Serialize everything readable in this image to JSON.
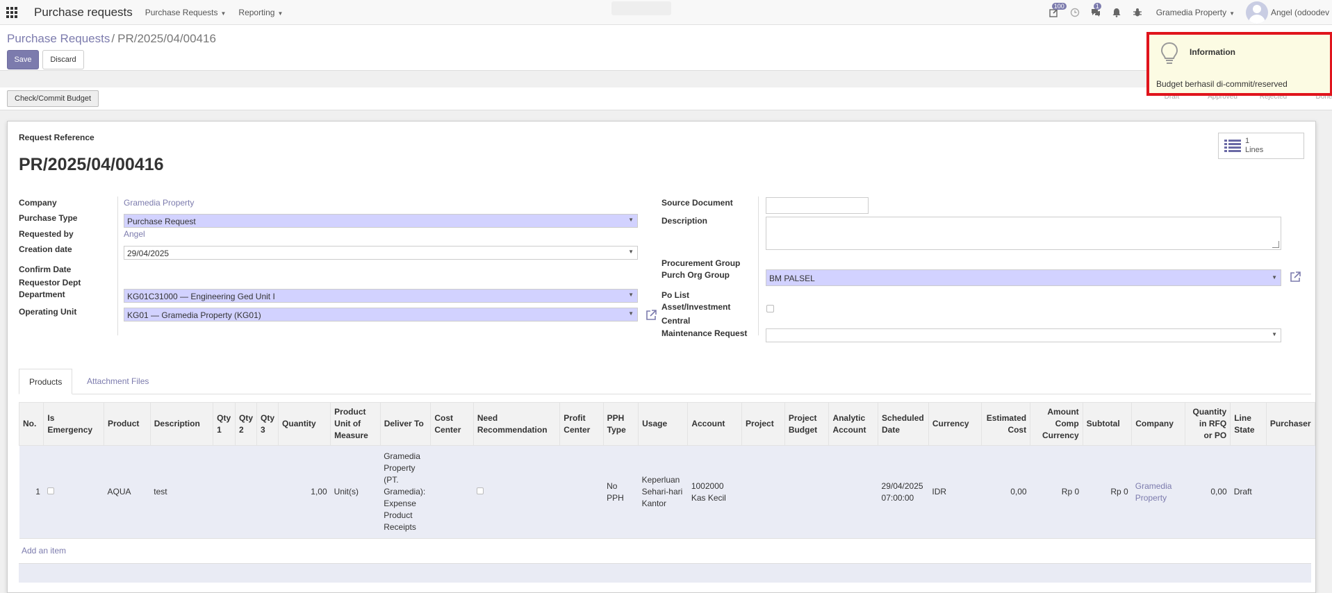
{
  "topnav": {
    "app_title": "Purchase requests",
    "menus": [
      "Purchase Requests",
      "Reporting"
    ],
    "badges": {
      "activities": "100",
      "messages": "1"
    },
    "company": "Gramedia Property",
    "user": "Angel (odoodev"
  },
  "control": {
    "breadcrumb_parent": "Purchase Requests",
    "breadcrumb_sep": "/",
    "breadcrumb_current": "PR/2025/04/00416",
    "save_label": "Save",
    "discard_label": "Discard"
  },
  "statusbar": {
    "commit_label": "Check/Commit Budget",
    "stages": [
      "Draft",
      "Approved",
      "Rejected",
      "Done"
    ]
  },
  "notification": {
    "title": "Information",
    "message": "Budget berhasil di-commit/reserved"
  },
  "lines_button": {
    "count": "1",
    "label": "Lines"
  },
  "form": {
    "ref_label": "Request Reference",
    "ref_value": "PR/2025/04/00416",
    "left": {
      "company_label": "Company",
      "company_value": "Gramedia Property",
      "purchase_type_label": "Purchase Type",
      "purchase_type_value": "Purchase Request",
      "requested_by_label": "Requested by",
      "requested_by_value": "Angel",
      "creation_date_label": "Creation date",
      "creation_date_value": "29/04/2025",
      "confirm_date_label": "Confirm Date",
      "requestor_dept_label": "Requestor Dept",
      "department_label": "Department",
      "department_value": "KG01C31000 — Engineering Ged Unit I",
      "operating_unit_label": "Operating Unit",
      "operating_unit_value": "KG01 — Gramedia Property (KG01)"
    },
    "right": {
      "source_document_label": "Source Document",
      "source_document_value": "",
      "description_label": "Description",
      "description_value": "",
      "procurement_group_label": "Procurement Group",
      "purch_org_group_label": "Purch Org Group",
      "purch_org_group_value": "BM PALSEL",
      "po_list_label": "Po List",
      "asset_investment_label": "Asset/Investment",
      "central_label": "Central",
      "maintenance_request_label": "Maintenance Request",
      "maintenance_request_value": ""
    }
  },
  "tabs": {
    "products": "Products",
    "attachments": "Attachment Files"
  },
  "table": {
    "headers": [
      "No.",
      "Is Emergency",
      "Product",
      "Description",
      "Qty 1",
      "Qty 2",
      "Qty 3",
      "Quantity",
      "Product Unit of Measure",
      "Deliver To",
      "Cost Center",
      "Need Recommendation",
      "Profit Center",
      "PPH Type",
      "Usage",
      "Account",
      "Project",
      "Project Budget",
      "Analytic Account",
      "Scheduled Date",
      "Currency",
      "Estimated Cost",
      "Amount Comp Currency",
      "Subtotal",
      "Company",
      "Quantity in RFQ or PO",
      "Line State",
      "Purchaser"
    ],
    "row": {
      "no": "1",
      "product": "AQUA",
      "description": "test",
      "quantity": "1,00",
      "uom": "Unit(s)",
      "deliver_to": "Gramedia Property (PT. Gramedia): Expense Product Receipts",
      "pph_type": "No PPH",
      "usage": "Keperluan Sehari-hari Kantor",
      "account": "1002000 Kas Kecil",
      "scheduled_date": "29/04/2025 07:00:00",
      "currency": "IDR",
      "estimated_cost": "0,00",
      "amount_comp": "Rp 0",
      "subtotal": "Rp 0",
      "company": "Gramedia Property",
      "qty_rfq": "0,00",
      "line_state": "Draft"
    },
    "add_item": "Add an item"
  }
}
